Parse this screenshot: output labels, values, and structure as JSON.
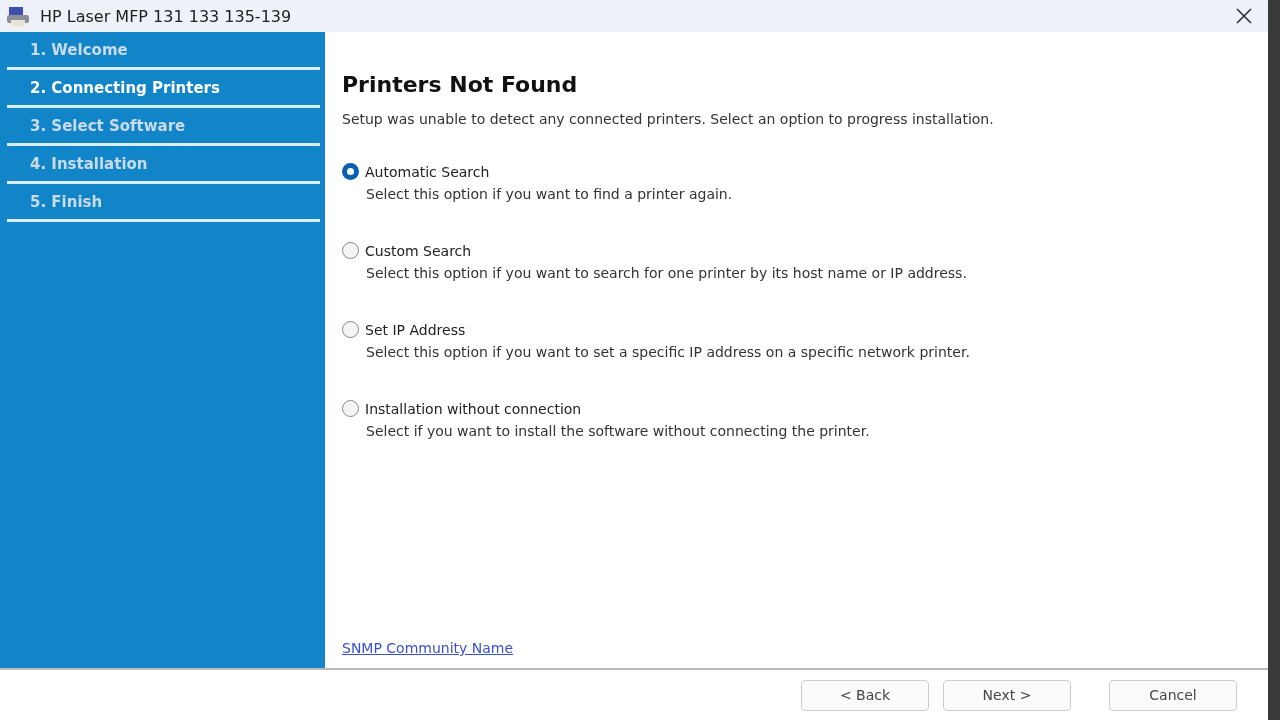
{
  "window": {
    "title": "HP Laser MFP 131 133 135-139"
  },
  "steps": [
    {
      "label": "1. Welcome",
      "selected": false
    },
    {
      "label": "2. Connecting Printers",
      "selected": true
    },
    {
      "label": "3. Select Software",
      "selected": false
    },
    {
      "label": "4. Installation",
      "selected": false
    },
    {
      "label": "5. Finish",
      "selected": false
    }
  ],
  "heading": "Printers Not Found",
  "intro": "Setup was unable to detect any connected printers. Select an option to progress installation.",
  "options": [
    {
      "label": "Automatic Search",
      "description": "Select this option if you want to find a printer again.",
      "selected": true
    },
    {
      "label": "Custom Search",
      "description": "Select this option if you want to search for one printer by its host name or IP address.",
      "selected": false
    },
    {
      "label": "Set IP Address",
      "description": "Select this option if you want to set a specific IP address on a specific network printer.",
      "selected": false
    },
    {
      "label": "Installation without connection",
      "description": "Select if you want to install the software without connecting the printer.",
      "selected": false
    }
  ],
  "link": "SNMP Community Name",
  "buttons": [
    "< Back",
    "Next >",
    "Cancel"
  ]
}
